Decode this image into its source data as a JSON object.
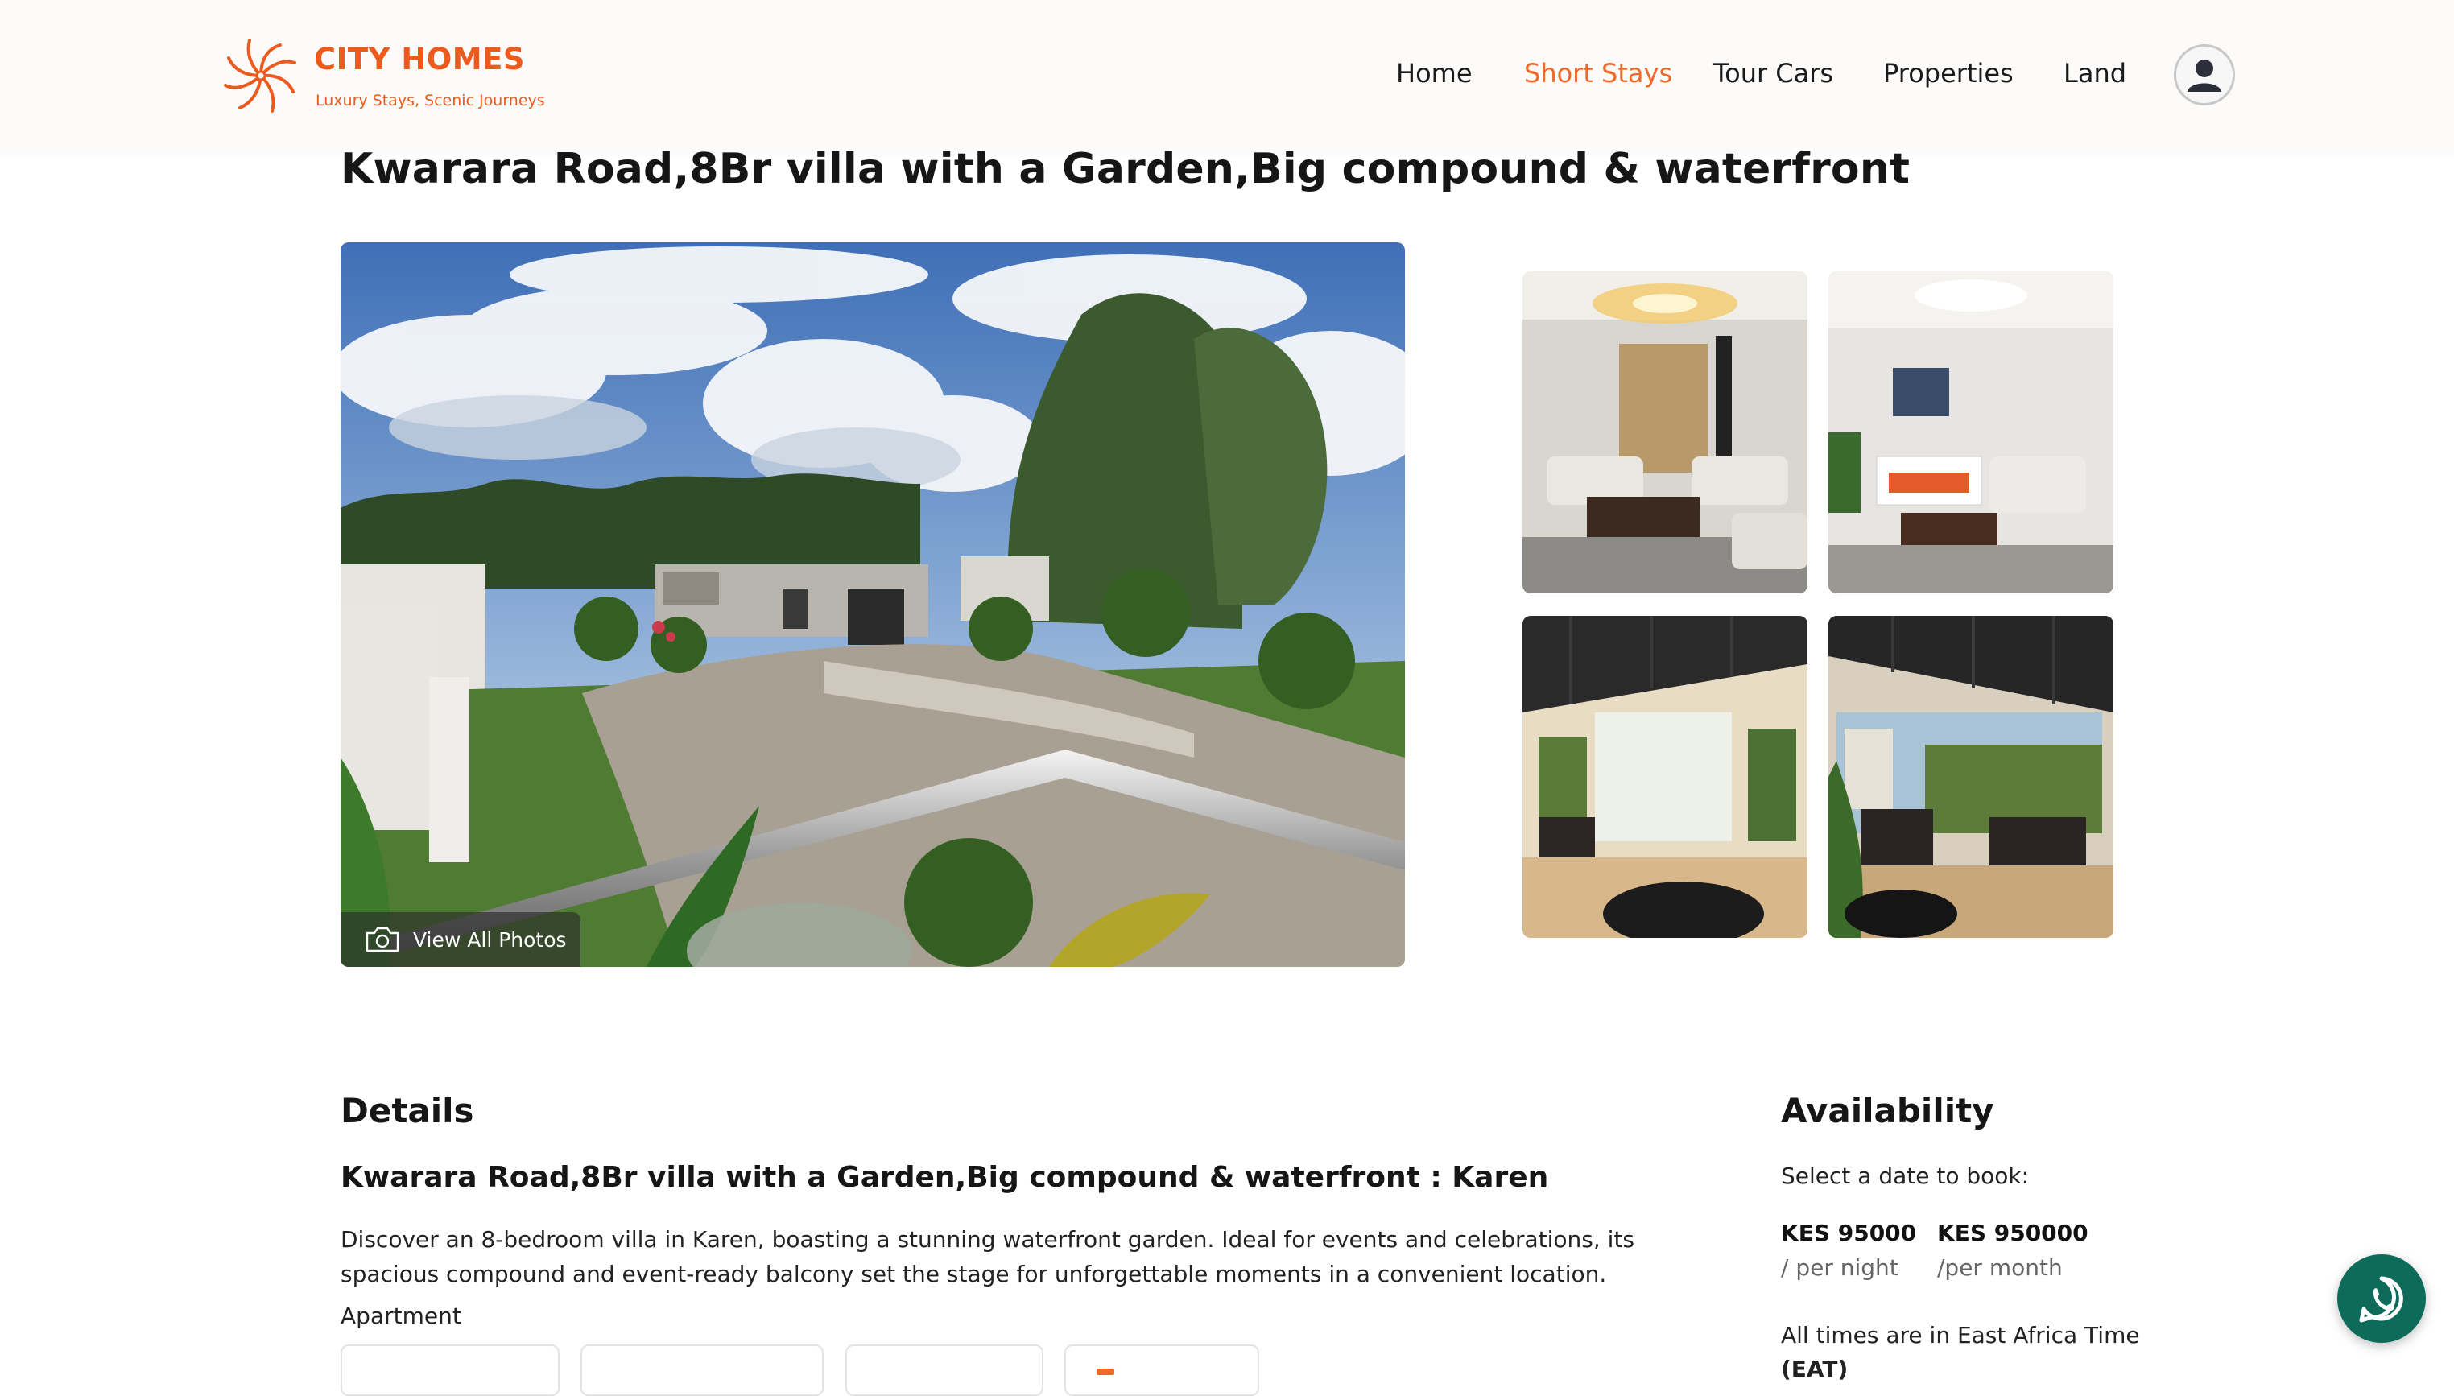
{
  "brand": {
    "name": "CITY HOMES",
    "tagline": "Luxury Stays, Scenic Journeys",
    "color": "#ec5a1d"
  },
  "nav": {
    "items": [
      {
        "label": "Home",
        "active": false
      },
      {
        "label": "Short Stays",
        "active": true
      },
      {
        "label": "Tour Cars",
        "active": false
      },
      {
        "label": "Properties",
        "active": false
      },
      {
        "label": "Land",
        "active": false
      }
    ],
    "active_color": "#ec6a2a",
    "avatar_icon": "user-avatar-icon"
  },
  "listing": {
    "title": "Kwarara Road,8Br villa with a Garden,Big compound & waterfront",
    "main_photo": {
      "icon": "camera-icon",
      "view_all_label": "View All Photos"
    },
    "thumbnails": [
      "living-room",
      "living-room-fireplace",
      "covered-terrace",
      "covered-terrace-lounge"
    ]
  },
  "details": {
    "heading": "Details",
    "subtitle": "Kwarara Road,8Br villa with a Garden,Big compound & waterfront : Karen",
    "description": "Discover an 8-bedroom villa in Karen, boasting a stunning waterfront garden. Ideal for events and celebrations, its spacious compound and event-ready balcony set the stage for unforgettable moments in a convenient location.",
    "type": "Apartment"
  },
  "availability": {
    "heading": "Availability",
    "select_label": "Select a date to book:",
    "prices": [
      {
        "amount": "KES 95000",
        "unit": " / per night"
      },
      {
        "amount": "KES 950000",
        "unit": " /per month"
      }
    ],
    "timezone_note": "All times are in East Africa Time",
    "timezone_abbr": "(EAT)"
  },
  "whatsapp": {
    "icon": "whatsapp-icon",
    "color": "#0e6b5a"
  }
}
